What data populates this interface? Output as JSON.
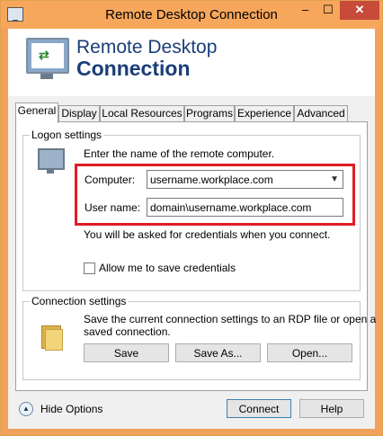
{
  "window": {
    "title": "Remote Desktop Connection"
  },
  "title_buttons": {
    "minimize": "–",
    "maximize": "☐",
    "close": "✕"
  },
  "banner": {
    "line1": "Remote Desktop",
    "line2": "Connection"
  },
  "tabs": [
    {
      "label": "General"
    },
    {
      "label": "Display"
    },
    {
      "label": "Local Resources"
    },
    {
      "label": "Programs"
    },
    {
      "label": "Experience"
    },
    {
      "label": "Advanced"
    }
  ],
  "logon": {
    "group_label": "Logon settings",
    "instruction": "Enter the name of the remote computer.",
    "computer_label": "Computer:",
    "computer_value": "username.workplace.com",
    "username_label": "User name:",
    "username_value": "domain\\username.workplace.com",
    "credentials_note": "You will be asked for credentials when you connect.",
    "save_credentials_label": "Allow me to save credentials"
  },
  "connection": {
    "group_label": "Connection settings",
    "description_line1": "Save the current connection settings to an RDP file or open a",
    "description_line2": "saved connection.",
    "save_label": "Save",
    "save_as_label": "Save As...",
    "open_label": "Open..."
  },
  "footer": {
    "hide_options_label": "Hide Options",
    "connect_label": "Connect",
    "help_label": "Help"
  },
  "icons": {
    "app": "remote-desktop-icon",
    "computer": "computer-icon",
    "folder": "folder-icon",
    "hide_options": "chevron-up-icon"
  },
  "colors": {
    "titlebar": "#f7a75c",
    "close_button": "#c74a3a",
    "banner_text": "#1a3e78",
    "highlight_box": "#e01b24"
  }
}
